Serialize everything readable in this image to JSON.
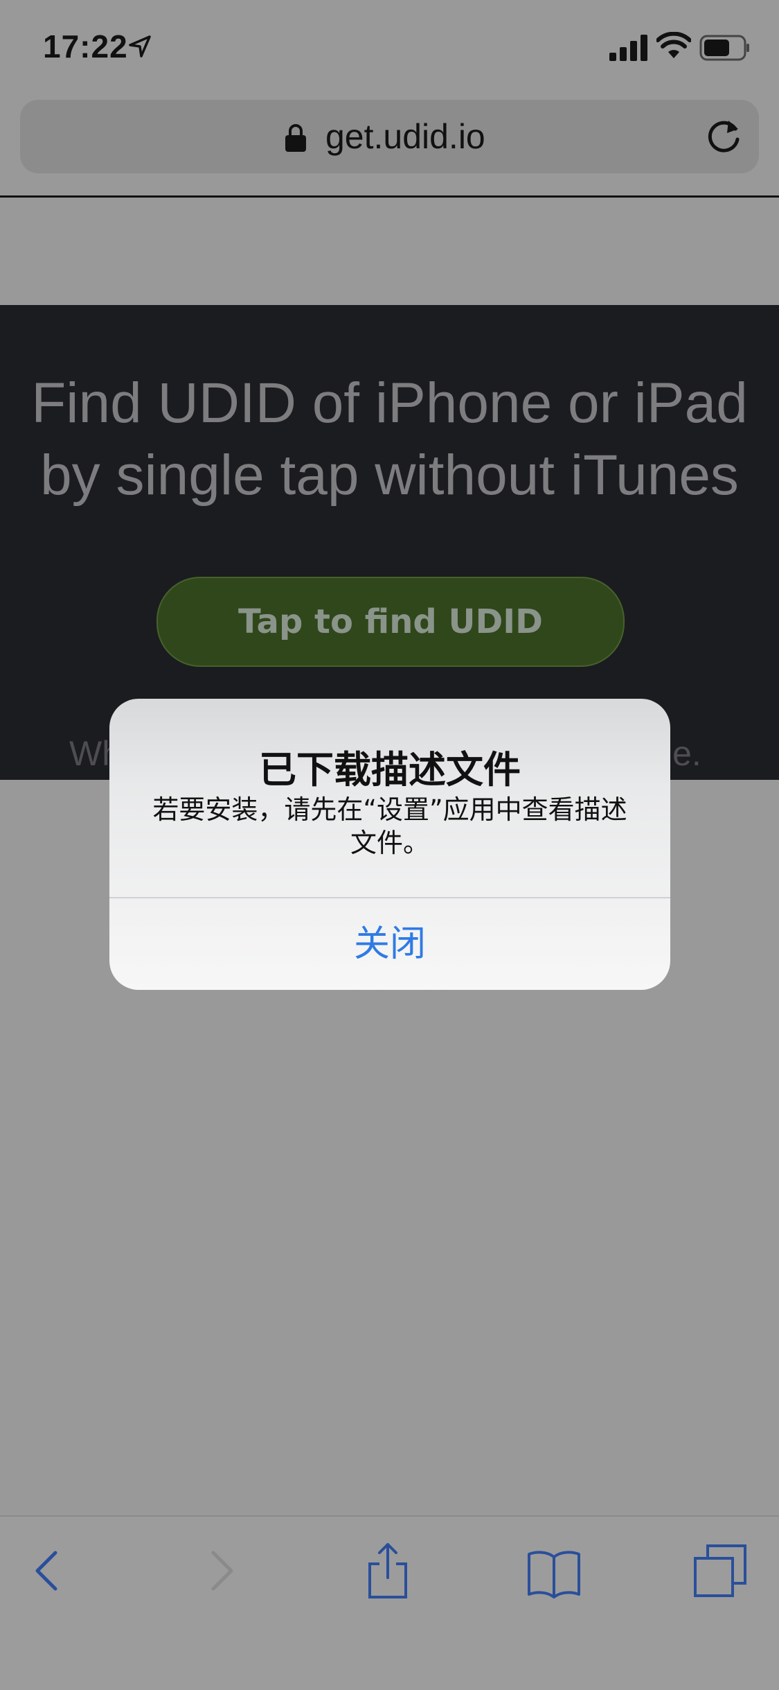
{
  "status_bar": {
    "time": "17:22"
  },
  "url_bar": {
    "url": "get.udid.io"
  },
  "hero": {
    "title_line1": "Find UDID of iPhone or iPad",
    "title_line2": "by single tap without iTunes",
    "button_label": "Tap to find UDID",
    "subtext_left": "Wh",
    "subtext_right": "le."
  },
  "dialog": {
    "title": "已下载描述文件",
    "message": "若要安装，请先在“设置”应用中查看描述文件。",
    "close_label": "关闭"
  },
  "colors": {
    "accent": "#2f7ae5",
    "hero_bg": "#1b1c20",
    "button_bg": "#2f471a",
    "overlay_bg": "#999999"
  },
  "icons": [
    "location-icon",
    "signal-icon",
    "wifi-icon",
    "battery-icon",
    "lock-icon",
    "reload-icon",
    "back-icon",
    "forward-icon",
    "share-icon",
    "bookmarks-icon",
    "tabs-icon"
  ]
}
